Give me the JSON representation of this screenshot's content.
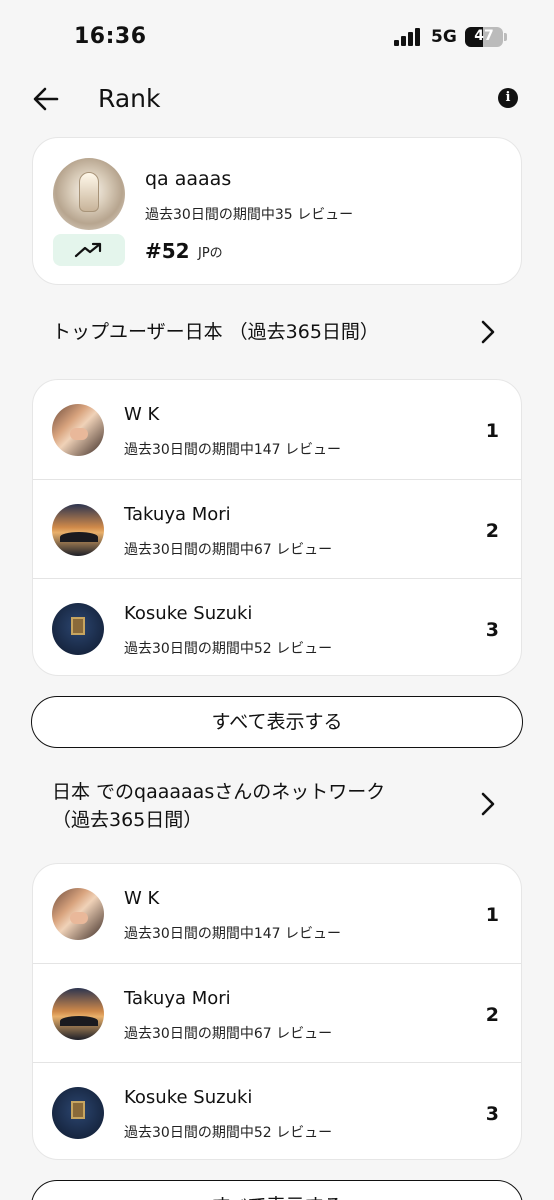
{
  "status_bar": {
    "time": "16:36",
    "network": "5G",
    "battery": "47"
  },
  "header": {
    "title": "Rank"
  },
  "profile": {
    "name": "qa aaaas",
    "reviews": "過去30日間の期間中35 レビュー",
    "rank": "#52",
    "country": "JPの"
  },
  "sections": [
    {
      "title_lines": [
        "トップユーザー日本 （過去365日間）"
      ],
      "users": [
        {
          "name": "W K",
          "reviews": "過去30日間の期間中147 レビュー",
          "rank": "1"
        },
        {
          "name": "Takuya Mori",
          "reviews": "過去30日間の期間中67 レビュー",
          "rank": "2"
        },
        {
          "name": "Kosuke Suzuki",
          "reviews": "過去30日間の期間中52 レビュー",
          "rank": "3"
        }
      ],
      "show_all": "すべて表示する"
    },
    {
      "title_lines": [
        "日本 でのqaaaaasさんのネットワーク",
        "（過去365日間）"
      ],
      "users": [
        {
          "name": "W K",
          "reviews": "過去30日間の期間中147 レビュー",
          "rank": "1"
        },
        {
          "name": "Takuya Mori",
          "reviews": "過去30日間の期間中67 レビュー",
          "rank": "2"
        },
        {
          "name": "Kosuke Suzuki",
          "reviews": "過去30日間の期間中52 レビュー",
          "rank": "3"
        }
      ],
      "show_all": "すべて表示する"
    }
  ]
}
